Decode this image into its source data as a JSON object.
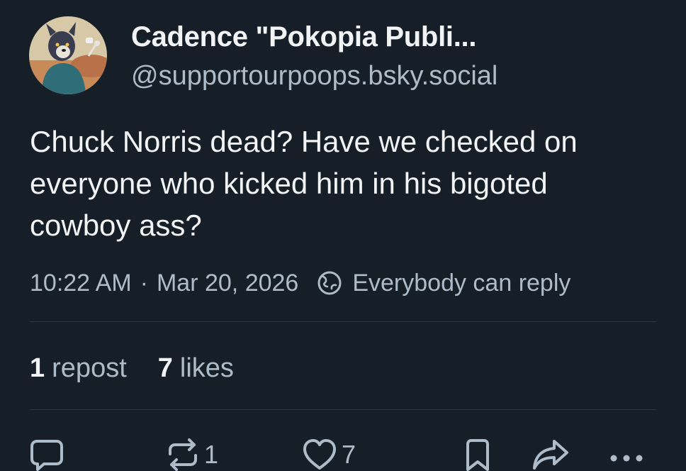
{
  "author": {
    "display_name": "Cadence \"Pokopia Publi...",
    "handle": "@supportourpoops.bsky.social"
  },
  "post": {
    "text": "Chuck Norris dead? Have we checked on everyone who kicked him in his bigoted cowboy ass?",
    "time": "10:22 AM",
    "separator": "·",
    "date": "Mar 20, 2026",
    "reply_setting": "Everybody can reply"
  },
  "stats": {
    "reposts_count": "1",
    "reposts_label": "repost",
    "likes_count": "7",
    "likes_label": "likes"
  },
  "actions": {
    "reply_icon": "speech-bubble-icon",
    "repost_icon": "repost-arrows-icon",
    "repost_count": "1",
    "like_icon": "heart-icon",
    "like_count": "7",
    "bookmark_icon": "bookmark-icon",
    "share_icon": "share-arrow-icon",
    "more_icon": "ellipsis-icon"
  },
  "colors": {
    "background": "#161e27",
    "text_primary": "#f1f3f5",
    "text_secondary": "#aebbc9",
    "divider": "#2c3744"
  }
}
